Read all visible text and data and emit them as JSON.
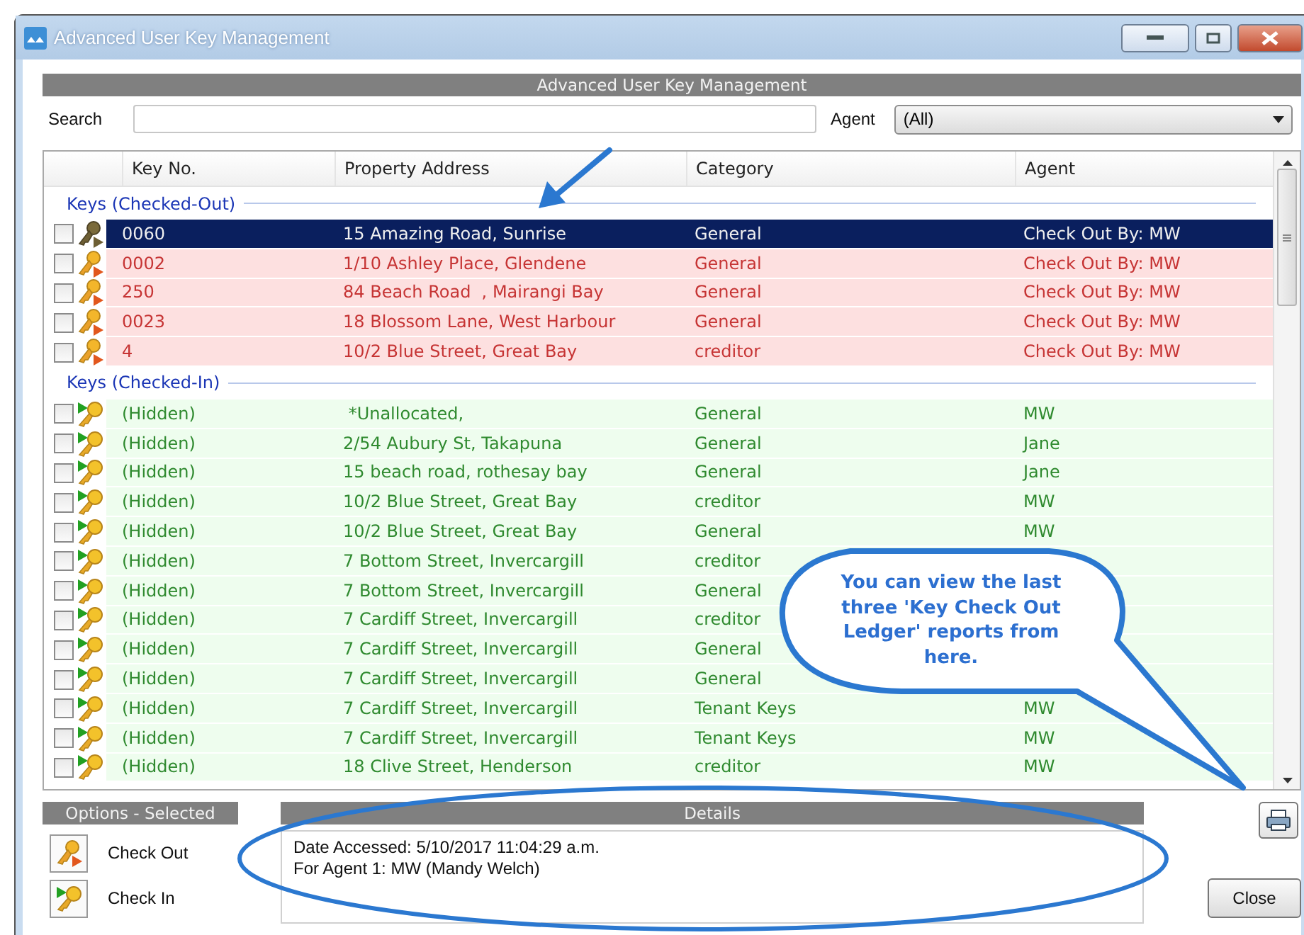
{
  "window": {
    "title": "Advanced User Key Management"
  },
  "panel_title": "Advanced User Key Management",
  "search": {
    "label": "Search"
  },
  "agent_filter": {
    "label": "Agent",
    "value": "(All)"
  },
  "table": {
    "columns": [
      "Key No.",
      "Property Address",
      "Category",
      "Agent"
    ],
    "groups": [
      {
        "title": "Keys (Checked-Out)",
        "kind": "checked_out",
        "rows": [
          {
            "key": "0060",
            "address": "15 Amazing Road, Sunrise",
            "category": "General",
            "agent": "Check Out By: MW",
            "checked": false,
            "selected": true
          },
          {
            "key": "0002",
            "address": "1/10 Ashley Place, Glendene",
            "category": "General",
            "agent": "Check Out By: MW",
            "checked": false,
            "selected": false
          },
          {
            "key": "250",
            "address": "84 Beach Road  , Mairangi Bay",
            "category": "General",
            "agent": "Check Out By: MW",
            "checked": false,
            "selected": false
          },
          {
            "key": "0023",
            "address": "18 Blossom Lane, West Harbour",
            "category": "General",
            "agent": "Check Out By: MW",
            "checked": false,
            "selected": false
          },
          {
            "key": "4",
            "address": "10/2 Blue Street, Great Bay",
            "category": "creditor",
            "agent": "Check Out By: MW",
            "checked": false,
            "selected": false
          }
        ]
      },
      {
        "title": "Keys (Checked-In)",
        "kind": "checked_in",
        "rows": [
          {
            "key": "(Hidden)",
            "address": " *Unallocated,",
            "category": "General",
            "agent": "MW",
            "checked": false,
            "selected": false
          },
          {
            "key": "(Hidden)",
            "address": "2/54 Aubury St, Takapuna",
            "category": "General",
            "agent": "Jane",
            "checked": false,
            "selected": false
          },
          {
            "key": "(Hidden)",
            "address": "15 beach road, rothesay bay",
            "category": "General",
            "agent": "Jane",
            "checked": false,
            "selected": false
          },
          {
            "key": "(Hidden)",
            "address": "10/2 Blue Street, Great Bay",
            "category": "creditor",
            "agent": "MW",
            "checked": false,
            "selected": false
          },
          {
            "key": "(Hidden)",
            "address": "10/2 Blue Street, Great Bay",
            "category": "General",
            "agent": "MW",
            "checked": false,
            "selected": false
          },
          {
            "key": "(Hidden)",
            "address": "7 Bottom Street, Invercargill",
            "category": "creditor",
            "checked": false,
            "selected": false
          },
          {
            "key": "(Hidden)",
            "address": "7 Bottom Street, Invercargill",
            "category": "General",
            "checked": false,
            "selected": false
          },
          {
            "key": "(Hidden)",
            "address": "7 Cardiff Street, Invercargill",
            "category": "creditor",
            "checked": false,
            "selected": false
          },
          {
            "key": "(Hidden)",
            "address": "7 Cardiff Street, Invercargill",
            "category": "General",
            "checked": false,
            "selected": false
          },
          {
            "key": "(Hidden)",
            "address": "7 Cardiff Street, Invercargill",
            "category": "General",
            "checked": false,
            "selected": false
          },
          {
            "key": "(Hidden)",
            "address": "7 Cardiff Street, Invercargill",
            "category": "Tenant Keys",
            "agent": "MW",
            "checked": false,
            "selected": false
          },
          {
            "key": "(Hidden)",
            "address": "7 Cardiff Street, Invercargill",
            "category": "Tenant Keys",
            "agent": "MW",
            "checked": false,
            "selected": false
          },
          {
            "key": "(Hidden)",
            "address": "18 Clive Street, Henderson",
            "category": "creditor",
            "agent": "MW",
            "checked": false,
            "selected": false
          }
        ]
      }
    ]
  },
  "options": {
    "title": "Options - Selected",
    "items": [
      {
        "label": "Check Out",
        "kind": "check_out"
      },
      {
        "label": "Check In",
        "kind": "check_in"
      }
    ]
  },
  "details": {
    "title": "Details",
    "lines": [
      "Date Accessed: 5/10/2017 11:04:29 a.m.",
      "For Agent 1: MW (Mandy Welch)"
    ]
  },
  "close_button": "Close",
  "callout": {
    "text": "You can view the last three 'Key Check Out Ledger' reports from here."
  }
}
